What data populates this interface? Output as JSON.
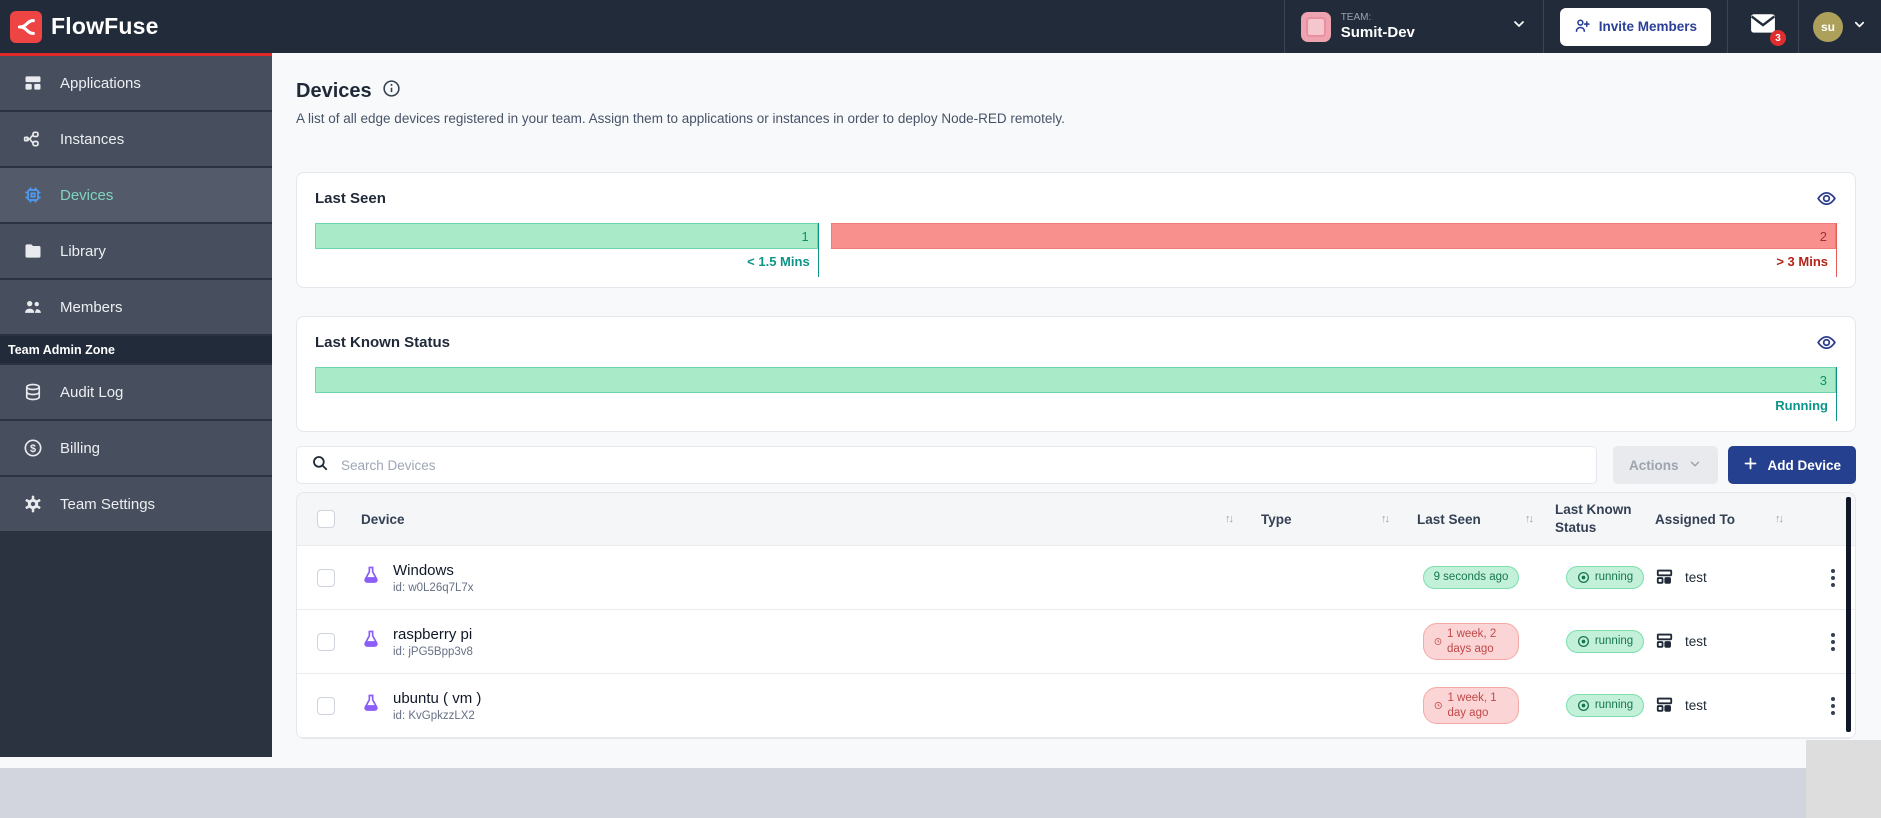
{
  "navbar": {
    "logo_text": "FlowFuse",
    "team_label": "TEAM:",
    "team_name": "Sumit-Dev",
    "invite_button_label": "Invite Members",
    "notification_count": "3",
    "avatar_initials": "su"
  },
  "sidebar": {
    "items": [
      {
        "label": "Applications"
      },
      {
        "label": "Instances"
      },
      {
        "label": "Devices"
      },
      {
        "label": "Library"
      },
      {
        "label": "Members"
      }
    ],
    "section_label": "Team Admin Zone",
    "admin_items": [
      {
        "label": "Audit Log"
      },
      {
        "label": "Billing"
      },
      {
        "label": "Team Settings"
      }
    ]
  },
  "page": {
    "title": "Devices",
    "description": "A list of all edge devices registered in your team. Assign them to applications or instances in order to deploy Node-RED remotely."
  },
  "chart_data": [
    {
      "type": "bar",
      "title": "Last Seen",
      "categories": [
        "< 1.5 Mins",
        "> 3 Mins"
      ],
      "values": [
        1,
        2
      ],
      "colors": [
        "#A9EBC9",
        "#F8918E"
      ],
      "segments": [
        {
          "value": "1",
          "label": "< 1.5 Mins"
        },
        {
          "value": "2",
          "label": "> 3 Mins"
        }
      ]
    },
    {
      "type": "bar",
      "title": "Last Known Status",
      "categories": [
        "Running"
      ],
      "values": [
        3
      ],
      "colors": [
        "#A9EBC9"
      ],
      "segments": [
        {
          "value": "3",
          "label": "Running"
        }
      ]
    }
  ],
  "toolbar": {
    "search_placeholder": "Search Devices",
    "actions_label": "Actions",
    "add_device_label": "Add Device"
  },
  "table": {
    "headers": [
      "Device",
      "Type",
      "Last Seen",
      "Last Known Status",
      "Assigned To"
    ],
    "rows": [
      {
        "name": "Windows",
        "id": "id: w0L26q7L7x",
        "last_seen": "9 seconds ago",
        "status": "running",
        "assigned_to": "test"
      },
      {
        "name": "raspberry pi",
        "id": "id: jPG5Bpp3v8",
        "last_seen": "1 week, 2 days ago",
        "status": "running",
        "assigned_to": "test"
      },
      {
        "name": "ubuntu ( vm )",
        "id": "id: KvGpkzzLX2",
        "last_seen": "1 week, 1 day ago",
        "status": "running",
        "assigned_to": "test"
      }
    ]
  },
  "icons": {
    "dollar": "$"
  },
  "colors": {
    "accent_red": "#E02A2A",
    "brand_red": "#EE4444",
    "navbar_bg": "#222B3A",
    "sidebar_bg": "#474E5D",
    "active_item_text": "#7FD4BC",
    "active_item_icon": "#4E9CF5",
    "navy_button": "#25408F",
    "green_bar": "#A9EBC9",
    "red_bar": "#F8918E",
    "teal_text": "#0D9488",
    "red_text": "#B42318",
    "badge_green_bg": "#C3F0D8",
    "badge_red_bg": "#FBD5D5",
    "flask_purple": "#8B5CF6"
  }
}
